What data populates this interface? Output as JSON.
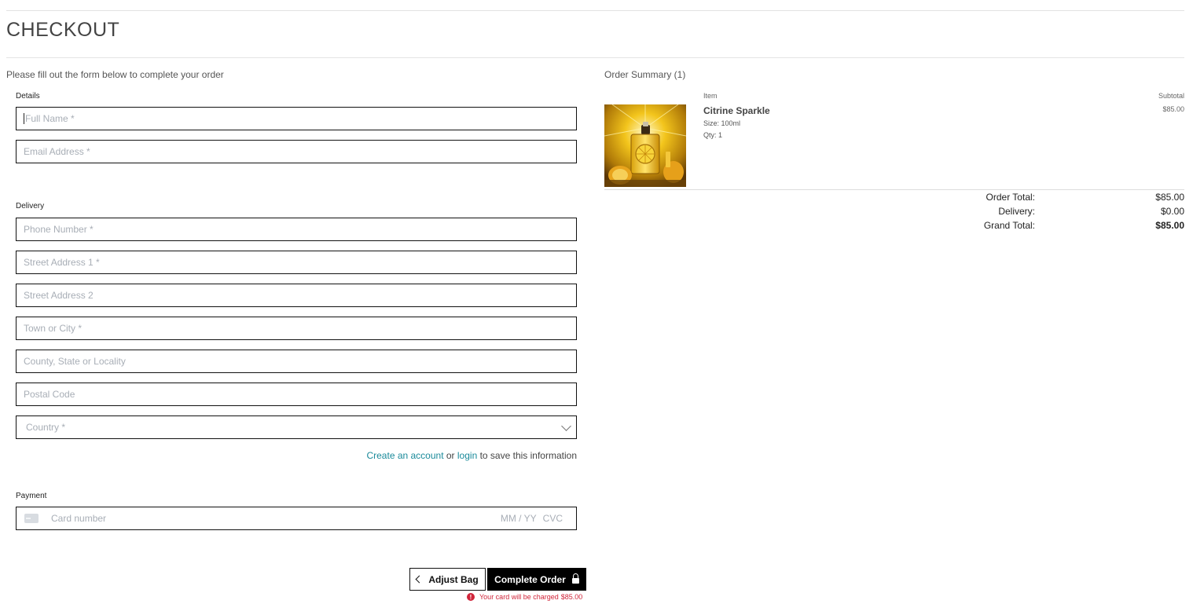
{
  "page": {
    "title": "CHECKOUT"
  },
  "form": {
    "intro": "Please fill out the form below to complete your order",
    "details_label": "Details",
    "delivery_label": "Delivery",
    "payment_label": "Payment",
    "fields": {
      "full_name": "Full Name *",
      "email": "Email Address *",
      "phone": "Phone Number *",
      "street1": "Street Address 1 *",
      "street2": "Street Address 2",
      "town": "Town or City *",
      "county": "County, State or Locality",
      "postcode": "Postal Code",
      "country": "Country *"
    },
    "account": {
      "create_link": "Create an account",
      "or": "or",
      "login_link": "login",
      "suffix": "to save this information"
    },
    "card": {
      "number_placeholder": "Card number",
      "exp_placeholder": "MM / YY",
      "cvc_placeholder": "CVC"
    },
    "buttons": {
      "adjust_bag": "Adjust Bag",
      "complete_order": "Complete Order"
    },
    "charge_note_prefix": "Your card will be charged",
    "charge_amount": "$85.00"
  },
  "summary": {
    "title": "Order Summary (1)",
    "col_item": "Item",
    "col_subtotal": "Subtotal",
    "items": [
      {
        "name": "Citrine Sparkle",
        "size": "Size: 100ml",
        "qty": "Qty: 1",
        "subtotal": "$85.00"
      }
    ],
    "order_total_label": "Order Total:",
    "order_total": "$85.00",
    "delivery_label": "Delivery:",
    "delivery": "$0.00",
    "grand_total_label": "Grand Total:",
    "grand_total": "$85.00"
  },
  "colors": {
    "accent_link": "#1a8a9a",
    "error": "#d0253a",
    "primary_button": "#000000"
  },
  "icons": [
    "chevron-left-icon",
    "lock-icon",
    "chevron-down-icon",
    "card-icon",
    "alert-icon"
  ]
}
